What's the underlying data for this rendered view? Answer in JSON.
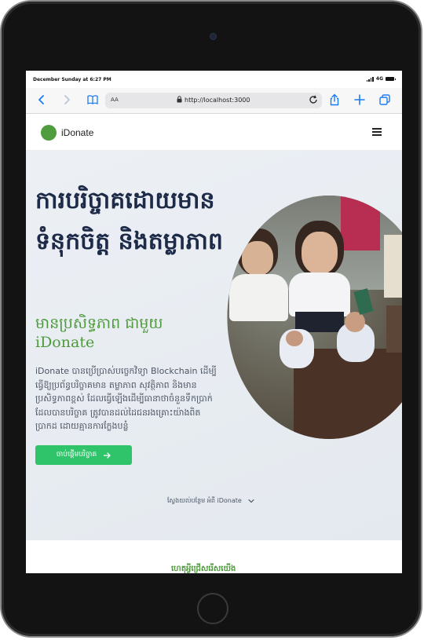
{
  "statusbar": {
    "time": "December Sunday at 6:27 PM",
    "network": "4G"
  },
  "browser": {
    "text_size": "AA",
    "url": "http://localhost:3000"
  },
  "site": {
    "brand": "iDonate"
  },
  "hero": {
    "title": "ការបរិច្ចាគដោយមានទំនុកចិត្ត និងតម្លាភាព",
    "subtitle": "មានប្រសិទ្ធភាព ជាមួយ iDonate",
    "description": "iDonate បានប្រើប្រាស់បច្ចេកវិទ្យា Blockchain ដើម្បីធ្វើឱ្យប្រព័ន្ធបរិច្ចាគមាន តម្លាភាព សុវត្ថិភាព និងមានប្រសិទ្ធភាពខ្ពស់ ដែលធ្វើឡើងដើម្បីធានាថាចំនួនទឹកប្រាក់ដែលបានបរិច្ចាគ ត្រូវបានដល់ដៃជនរងគ្រោះយ៉ាងពិតប្រាកដ ដោយគ្មានការក្លែងបន្លំ",
    "cta_label": "ចាប់ផ្តើមបរិច្ចាគ",
    "more_label": "ស្វែងយល់បន្ថែម អំពី iDonate"
  },
  "section2": {
    "title": "ហេតុអ្វីជ្រើសរើសយើង"
  },
  "colors": {
    "accent": "#2fc36a",
    "brand_green": "#4e9a3c",
    "title_navy": "#1e2b48",
    "link_blue": "#1a7cf5"
  }
}
